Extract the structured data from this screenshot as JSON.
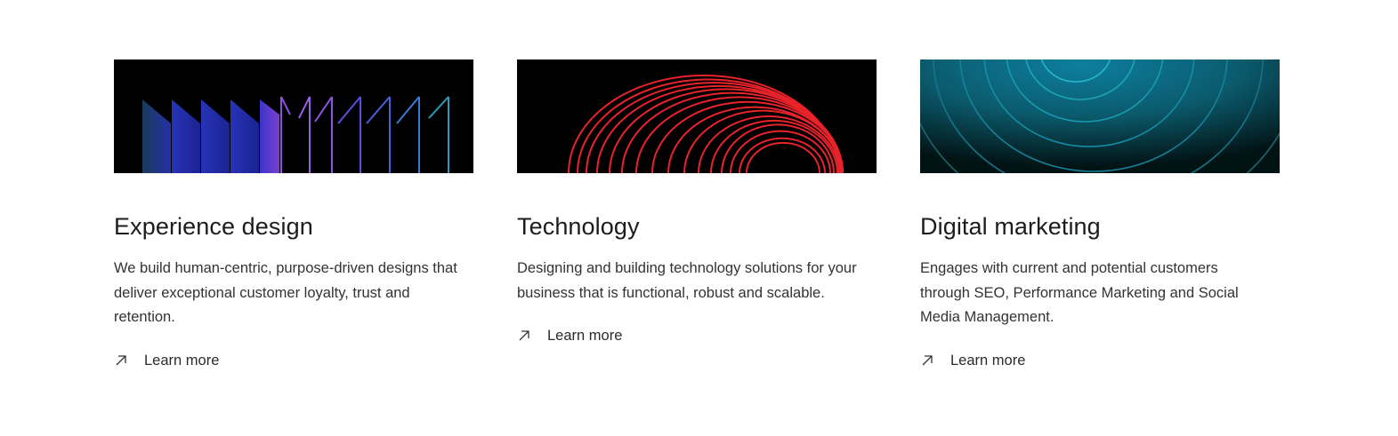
{
  "cards": [
    {
      "title": "Experience design",
      "description": "We build human-centric, purpose-driven designs that deliver exceptional customer loyalty, trust and retention.",
      "link_label": "Learn more",
      "icon": "arrow-up-right-icon",
      "image": "abstract-blue-purple-panels"
    },
    {
      "title": "Technology",
      "description": "Designing and building technology solutions for your business that is functional, robust and scalable.",
      "link_label": "Learn more",
      "icon": "arrow-up-right-icon",
      "image": "abstract-red-arcs"
    },
    {
      "title": "Digital marketing",
      "description": "Engages with current and potential customers through SEO, Performance Marketing and Social Media Management.",
      "link_label": "Learn more",
      "icon": "arrow-up-right-icon",
      "image": "abstract-teal-waves"
    }
  ],
  "colors": {
    "background": "#ffffff",
    "text": "#1c1c1c",
    "image_bg": "#000000",
    "accent_red": "#e8232a",
    "accent_teal": "#1aa6b4",
    "accent_blue": "#3a3fd9"
  }
}
